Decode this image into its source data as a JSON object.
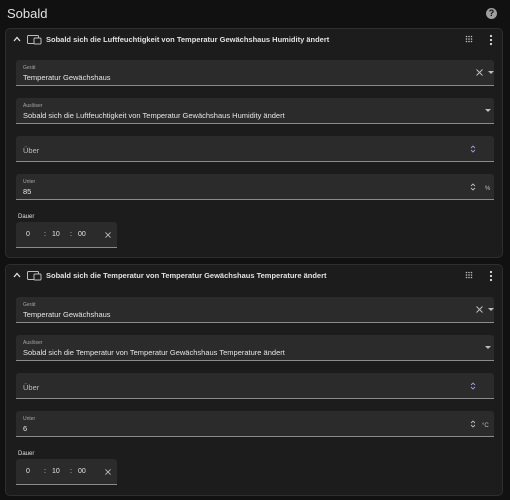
{
  "page": {
    "title": "Sobald"
  },
  "icons": {
    "help": "help-circle-icon",
    "collapse": "chevron-up-icon",
    "device": "device-icon",
    "drag": "drag-handle-icon",
    "more": "more-vertical-icon"
  },
  "labels": {
    "device": "Gerät",
    "trigger": "Auslöser",
    "above": "Über",
    "below": "Unter",
    "duration": "Dauer"
  },
  "cards": [
    {
      "title": "Sobald sich die Luftfeuchtigkeit von Temperatur Gewächshaus Humidity ändert",
      "device": "Temperatur Gewächshaus",
      "trigger": "Sobald sich die Luftfeuchtigkeit von Temperatur Gewächshaus Humidity ändert",
      "above": "",
      "below": "85",
      "unit": "%",
      "duration": {
        "hours": "0",
        "minutes": "10",
        "seconds": "00"
      }
    },
    {
      "title": "Sobald sich die Temperatur von Temperatur Gewächshaus Temperature ändert",
      "device": "Temperatur Gewächshaus",
      "trigger": "Sobald sich die Temperatur von Temperatur Gewächshaus Temperature ändert",
      "above": "",
      "below": "6",
      "unit": "°C",
      "duration": {
        "hours": "0",
        "minutes": "10",
        "seconds": "00"
      }
    }
  ]
}
